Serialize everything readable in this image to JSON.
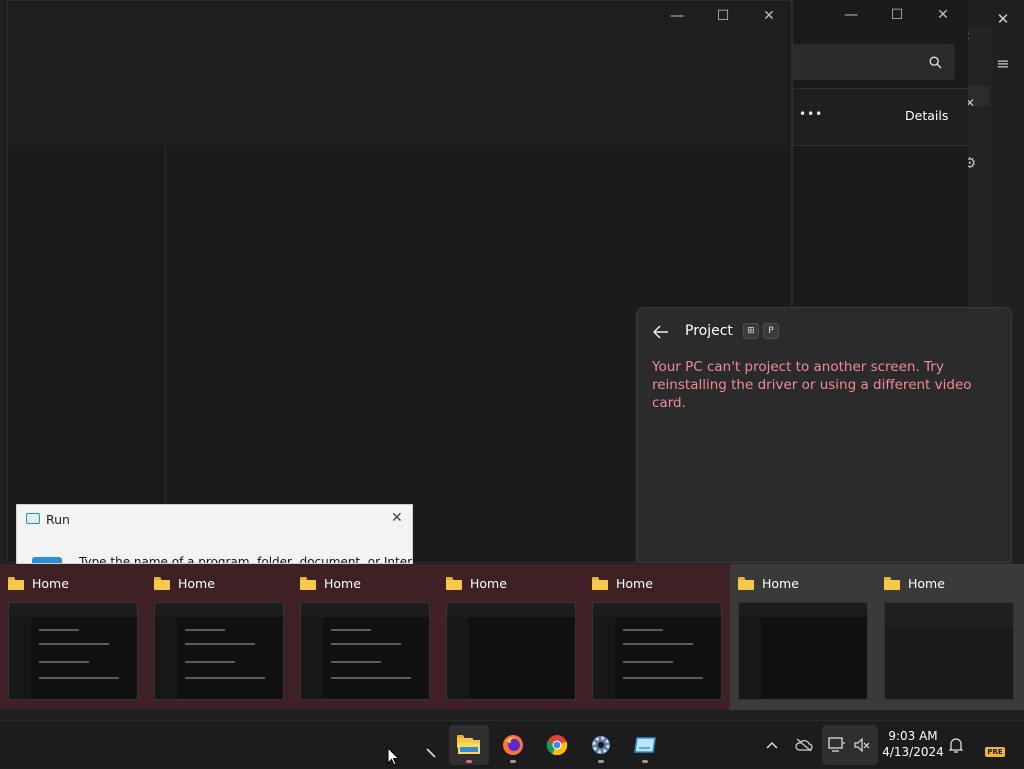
{
  "back_window": {
    "close_glyph": "✕",
    "menu_glyph": "≡"
  },
  "mid_window": {
    "more_label": "•••",
    "details_label": "Details",
    "minimize": "—",
    "maximize": "☐",
    "close": "✕"
  },
  "front_window": {
    "minimize": "—",
    "maximize": "☐",
    "close": "✕"
  },
  "project_flyout": {
    "title": "Project",
    "shortcut_win": "⊞",
    "shortcut_key": "P",
    "message": "Your PC can't project to another screen. Try reinstalling the driver or using a different video card."
  },
  "run_dialog": {
    "title": "Run",
    "prompt": "Type the name of a program, folder, document, or Internet",
    "close": "✕"
  },
  "thumbnails": [
    {
      "title": "Home"
    },
    {
      "title": "Home"
    },
    {
      "title": "Home"
    },
    {
      "title": "Home"
    },
    {
      "title": "Home"
    },
    {
      "title": "Home"
    },
    {
      "title": "Home"
    }
  ],
  "taskbar": {
    "time": "9:03 AM",
    "date": "4/13/2024",
    "apps": [
      "file-explorer",
      "firefox",
      "chrome",
      "settings",
      "run"
    ],
    "pre_badge": "PRE"
  },
  "colors": {
    "error_text": "#f08a98",
    "hover_thumb": "#3f2024",
    "taskbar": "#1c1c1c"
  }
}
